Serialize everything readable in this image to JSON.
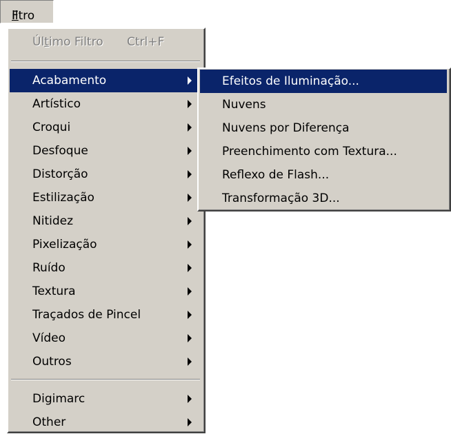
{
  "menubar": {
    "menu_prefix": "",
    "menu_accel": "F",
    "menu_rest": "iltro"
  },
  "main_menu": {
    "last_filter": {
      "label_pre": "Úl",
      "label_accel": "t",
      "label_post": "imo Filtro",
      "shortcut": "Ctrl+F",
      "enabled": false
    },
    "group1": [
      {
        "label": "Acabamento",
        "submenu": true,
        "selected": true
      },
      {
        "label": "Artístico",
        "submenu": true
      },
      {
        "label": "Croqui",
        "submenu": true
      },
      {
        "label": "Desfoque",
        "submenu": true
      },
      {
        "label": "Distorção",
        "submenu": true
      },
      {
        "label": "Estilização",
        "submenu": true
      },
      {
        "label": "Nitidez",
        "submenu": true
      },
      {
        "label": "Pixelização",
        "submenu": true
      },
      {
        "label": "Ruído",
        "submenu": true
      },
      {
        "label": "Textura",
        "submenu": true
      },
      {
        "label": "Traçados de Pincel",
        "submenu": true
      },
      {
        "label": "Vídeo",
        "submenu": true
      },
      {
        "label": "Outros",
        "submenu": true
      }
    ],
    "group2": [
      {
        "label": "Digimarc",
        "submenu": true
      },
      {
        "label": "Other",
        "submenu": true
      }
    ]
  },
  "submenu": {
    "items": [
      {
        "label": "Efeitos de Iluminação...",
        "selected": true
      },
      {
        "label": "Nuvens"
      },
      {
        "label": "Nuvens por Diferença"
      },
      {
        "label": "Preenchimento com Textura..."
      },
      {
        "label": "Reflexo de Flash..."
      },
      {
        "label": "Transformação 3D..."
      }
    ]
  },
  "colors": {
    "menu_bg": "#d4d0c8",
    "highlight": "#0a246a",
    "disabled_text": "#808080"
  }
}
